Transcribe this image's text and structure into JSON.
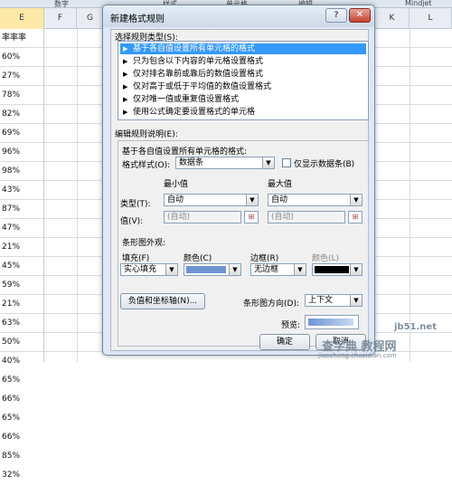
{
  "excel": {
    "ribbon": [
      "数字",
      "样式",
      "单元格",
      "编辑",
      "Mindjet"
    ],
    "col_headers": [
      "E",
      "F",
      "G",
      "K",
      "L"
    ],
    "col_e_cells": [
      "率率率",
      "60%",
      "27%",
      "78%",
      "82%",
      "69%",
      "96%",
      "98%",
      "43%",
      "87%",
      "47%",
      "21%",
      "45%",
      "59%",
      "21%",
      "63%",
      "50%",
      "40%",
      "65%",
      "66%",
      "65%",
      "66%",
      "85%",
      "32%"
    ]
  },
  "dialog": {
    "title": "新建格式规则",
    "help": "?",
    "close": "✕",
    "rule_type_label": "选择规则类型(S):",
    "rule_types": [
      "基于各自值设置所有单元格的格式",
      "只为包含以下内容的单元格设置格式",
      "仅对排名靠前或靠后的数值设置格式",
      "仅对高于或低于平均值的数值设置格式",
      "仅对唯一值或重复值设置格式",
      "使用公式确定要设置格式的单元格"
    ],
    "edit_label": "编辑规则说明(E):",
    "group_heading": "基于各自值设置所有单元格的格式:",
    "format_style_label": "格式样式(O):",
    "format_style_value": "数据条",
    "show_bar_only_label": "仅显示数据条(B)",
    "min_heading": "最小值",
    "max_heading": "最大值",
    "type_label": "类型(T):",
    "value_label": "值(V):",
    "min_type": "自动",
    "max_type": "自动",
    "min_value": "(自动)",
    "max_value": "(自动)",
    "bar_appearance_label": "条形图外观:",
    "fill_label": "填充(F)",
    "fill_value": "实心填充",
    "color_label": "颜色(C)",
    "border_label": "边框(R)",
    "border_value": "无边框",
    "border_color_label": "颜色(L)",
    "neg_axis_button": "负值和坐标轴(N)...",
    "bar_direction_label": "条形图方向(D):",
    "bar_direction_value": "上下文",
    "preview_label": "预览:",
    "ok_button": "确定",
    "cancel_button": "取消",
    "bar_color": "#6f94d4",
    "border_color": "#000000"
  },
  "watermark": {
    "line1": "jb51.net",
    "line2": "查字典 教程网",
    "line3": "jiaocheng.chazidian.com"
  }
}
